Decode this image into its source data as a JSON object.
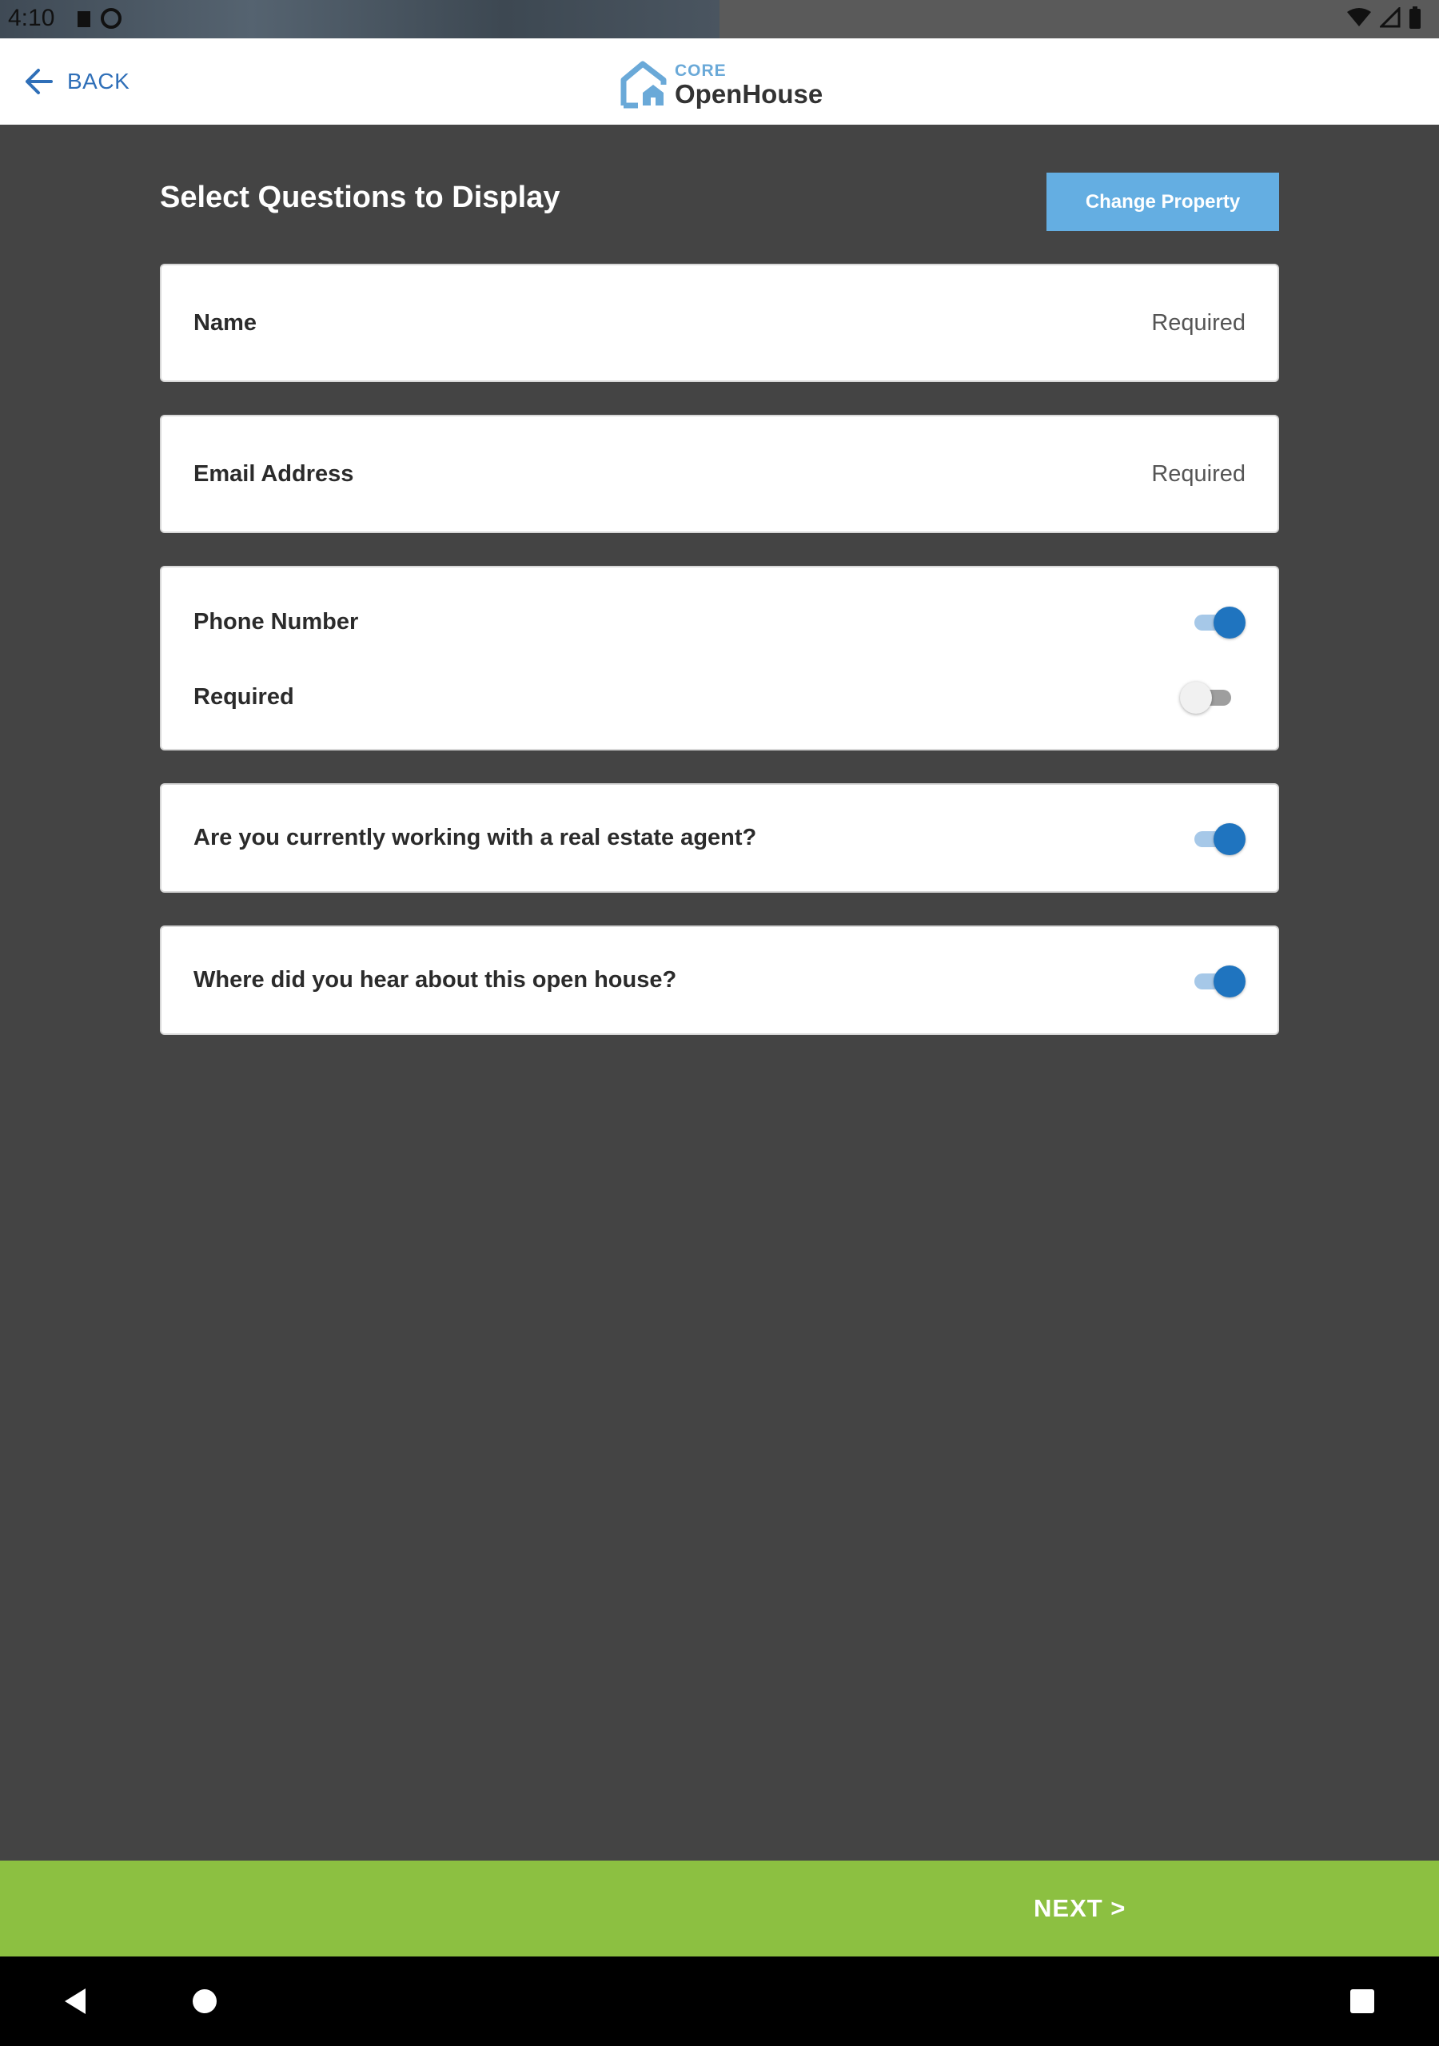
{
  "status_bar": {
    "time": "4:10",
    "icons": [
      "sim-icon",
      "sync-icon",
      "wifi-icon",
      "signal-icon",
      "battery-icon"
    ]
  },
  "header": {
    "back_label": "BACK",
    "logo_core": "CORE",
    "logo_name": "OpenHouse"
  },
  "main": {
    "title": "Select Questions to Display",
    "change_property_label": "Change Property",
    "questions": [
      {
        "label": "Name",
        "status": "Required"
      },
      {
        "label": "Email Address",
        "status": "Required"
      },
      {
        "label": "Phone Number",
        "enabled": true,
        "required_label": "Required",
        "required": false
      },
      {
        "label": "Are you currently working with a real estate agent?",
        "enabled": true
      },
      {
        "label": "Where did you hear about this open house?",
        "enabled": true
      }
    ]
  },
  "footer": {
    "next_label": "NEXT >"
  },
  "colors": {
    "background": "#444444",
    "accent_blue": "#1f74bf",
    "button_blue": "#64aee2",
    "next_green": "#8cc041"
  }
}
